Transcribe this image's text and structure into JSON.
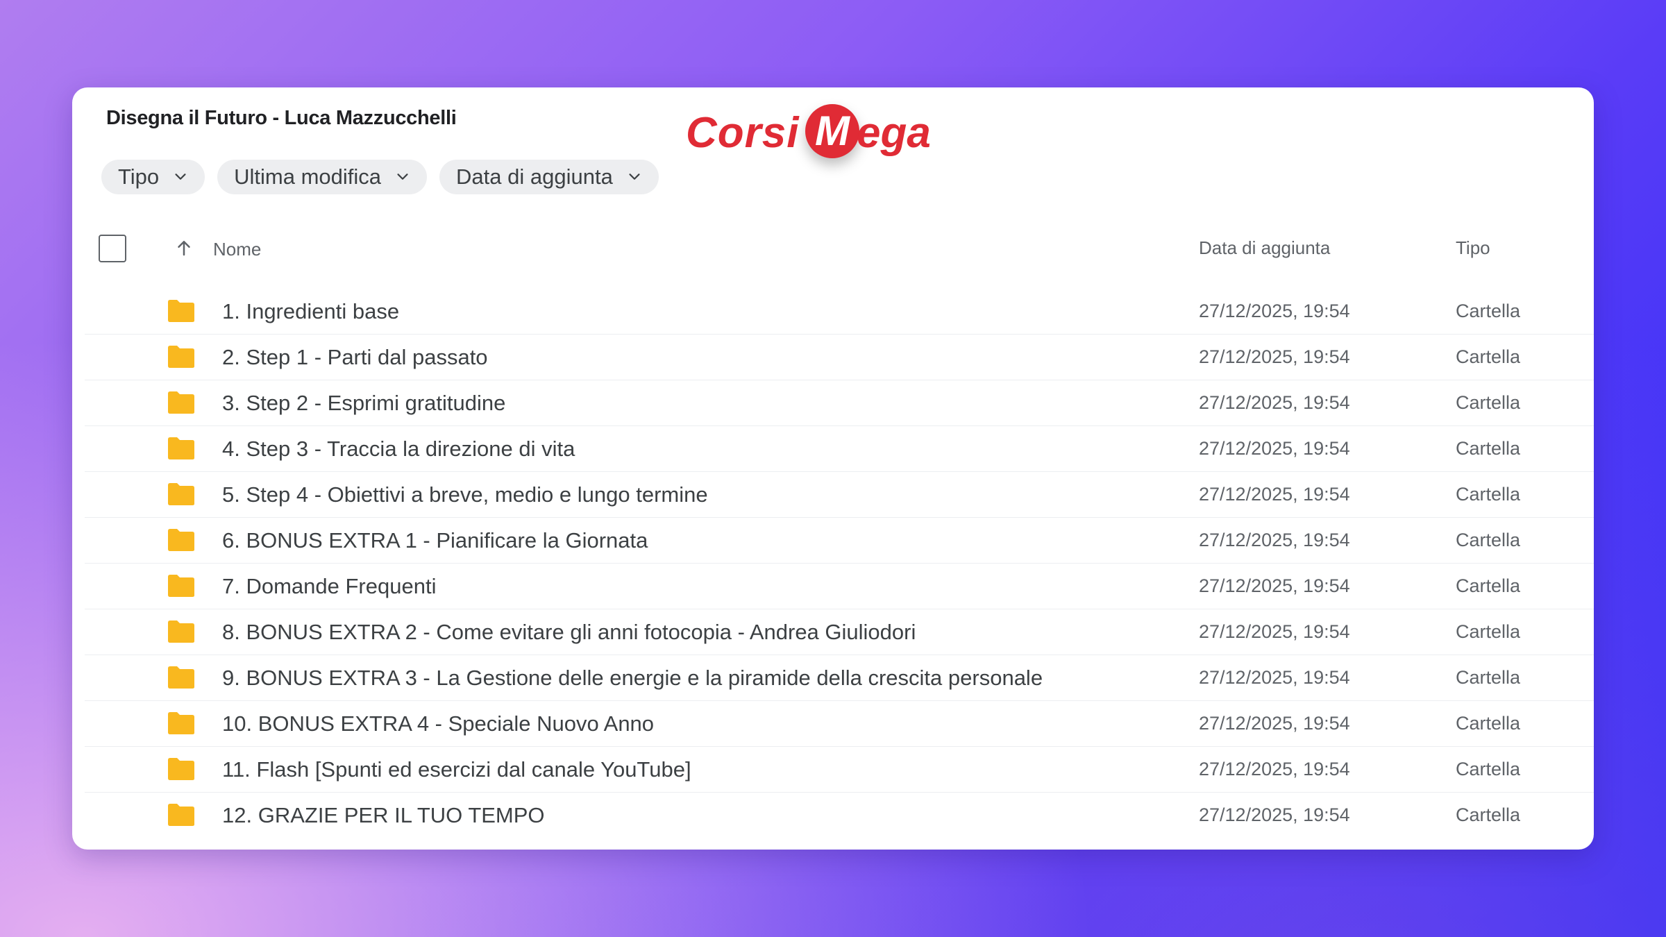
{
  "page": {
    "title": "Disegna il Futuro - Luca Mazzucchelli"
  },
  "logo": {
    "part1": "Corsi",
    "initial": "M",
    "part2": "ega",
    "color": "#e02b35"
  },
  "filters": [
    {
      "label": "Tipo",
      "icon": "chevron-down-icon"
    },
    {
      "label": "Ultima modifica",
      "icon": "chevron-down-icon"
    },
    {
      "label": "Data di aggiunta",
      "icon": "chevron-down-icon"
    }
  ],
  "table": {
    "columns": {
      "name": "Nome",
      "date_added": "Data di aggiunta",
      "type": "Tipo"
    },
    "sort_icon": "arrow-up-icon",
    "folder_color": "#f9b81f",
    "rows": [
      {
        "name": "1. Ingredienti base",
        "date": "27/12/2025, 19:54",
        "type": "Cartella"
      },
      {
        "name": "2. Step 1 - Parti dal passato",
        "date": "27/12/2025, 19:54",
        "type": "Cartella"
      },
      {
        "name": "3. Step 2 - Esprimi gratitudine",
        "date": "27/12/2025, 19:54",
        "type": "Cartella"
      },
      {
        "name": "4. Step 3 - Traccia la direzione di vita",
        "date": "27/12/2025, 19:54",
        "type": "Cartella"
      },
      {
        "name": "5. Step 4 - Obiettivi a breve, medio e lungo termine",
        "date": "27/12/2025, 19:54",
        "type": "Cartella"
      },
      {
        "name": "6. BONUS EXTRA 1 - Pianificare la Giornata",
        "date": "27/12/2025, 19:54",
        "type": "Cartella"
      },
      {
        "name": "7. Domande Frequenti",
        "date": "27/12/2025, 19:54",
        "type": "Cartella"
      },
      {
        "name": "8. BONUS EXTRA 2 - Come evitare gli anni fotocopia - Andrea Giuliodori",
        "date": "27/12/2025, 19:54",
        "type": "Cartella"
      },
      {
        "name": "9. BONUS EXTRA 3 - La Gestione delle energie e la piramide della crescita personale",
        "date": "27/12/2025, 19:54",
        "type": "Cartella"
      },
      {
        "name": "10. BONUS EXTRA 4 - Speciale Nuovo Anno",
        "date": "27/12/2025, 19:54",
        "type": "Cartella"
      },
      {
        "name": "11. Flash [Spunti ed esercizi dal canale YouTube]",
        "date": "27/12/2025, 19:54",
        "type": "Cartella"
      },
      {
        "name": "12. GRAZIE PER IL TUO TEMPO",
        "date": "27/12/2025, 19:54",
        "type": "Cartella"
      }
    ]
  }
}
